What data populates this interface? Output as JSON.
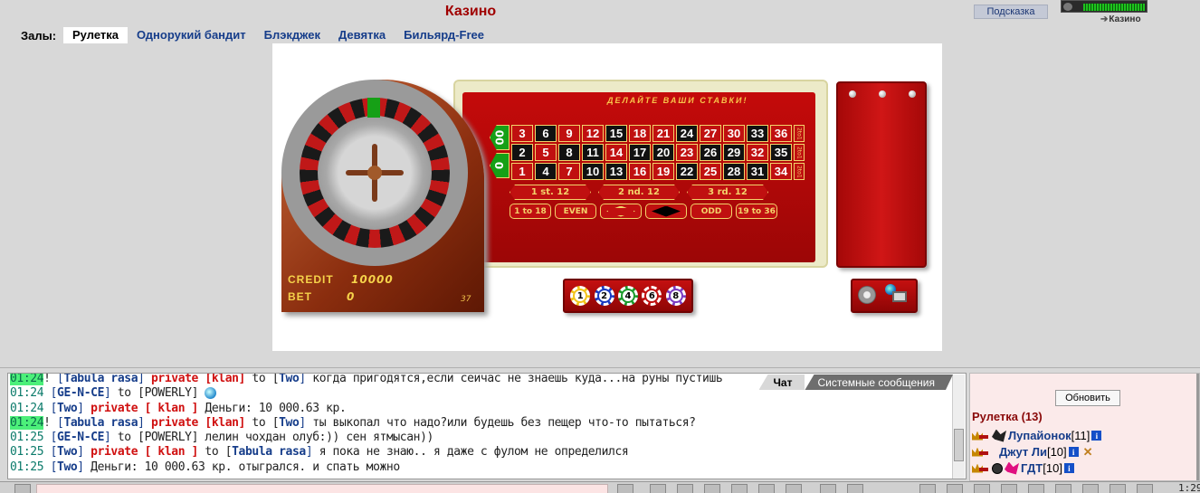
{
  "header": {
    "title": "Казино",
    "hint_button": "Подсказка",
    "status_link": "Казино",
    "halls_label": "Залы:",
    "tabs": [
      {
        "label": "Рулетка",
        "active": true
      },
      {
        "label": "Однорукий бандит",
        "active": false
      },
      {
        "label": "Блэкджек",
        "active": false
      },
      {
        "label": "Девятка",
        "active": false
      },
      {
        "label": "Бильярд-Free",
        "active": false
      }
    ]
  },
  "game": {
    "bets_title": "ДЕЛАЙТЕ ВАШИ СТАВКИ!",
    "credit_label": "CREDIT",
    "credit_value": "10000",
    "bet_label": "BET",
    "bet_value": "0",
    "spin_count": "37",
    "zero_cells": [
      "00",
      "0"
    ],
    "grid_rows": [
      [
        {
          "n": "3",
          "c": "red"
        },
        {
          "n": "6",
          "c": "black"
        },
        {
          "n": "9",
          "c": "red"
        },
        {
          "n": "12",
          "c": "red"
        },
        {
          "n": "15",
          "c": "black"
        },
        {
          "n": "18",
          "c": "red"
        },
        {
          "n": "21",
          "c": "red"
        },
        {
          "n": "24",
          "c": "black"
        },
        {
          "n": "27",
          "c": "red"
        },
        {
          "n": "30",
          "c": "red"
        },
        {
          "n": "33",
          "c": "black"
        },
        {
          "n": "36",
          "c": "red"
        }
      ],
      [
        {
          "n": "2",
          "c": "black"
        },
        {
          "n": "5",
          "c": "red"
        },
        {
          "n": "8",
          "c": "black"
        },
        {
          "n": "11",
          "c": "black"
        },
        {
          "n": "14",
          "c": "red"
        },
        {
          "n": "17",
          "c": "black"
        },
        {
          "n": "20",
          "c": "black"
        },
        {
          "n": "23",
          "c": "red"
        },
        {
          "n": "26",
          "c": "black"
        },
        {
          "n": "29",
          "c": "black"
        },
        {
          "n": "32",
          "c": "red"
        },
        {
          "n": "35",
          "c": "black"
        }
      ],
      [
        {
          "n": "1",
          "c": "red"
        },
        {
          "n": "4",
          "c": "black"
        },
        {
          "n": "7",
          "c": "red"
        },
        {
          "n": "10",
          "c": "black"
        },
        {
          "n": "13",
          "c": "black"
        },
        {
          "n": "16",
          "c": "red"
        },
        {
          "n": "19",
          "c": "red"
        },
        {
          "n": "22",
          "c": "black"
        },
        {
          "n": "25",
          "c": "red"
        },
        {
          "n": "28",
          "c": "black"
        },
        {
          "n": "31",
          "c": "black"
        },
        {
          "n": "34",
          "c": "red"
        }
      ]
    ],
    "column_bet": "2to1",
    "dozens": [
      "1 st. 12",
      "2 nd. 12",
      "3 rd. 12"
    ],
    "outside": [
      "1 to 18",
      "EVEN",
      "ODD",
      "19 to 36"
    ],
    "chips": [
      "1",
      "2",
      "4",
      "6",
      "8"
    ],
    "chip_colors": [
      "#f2c41a",
      "#1a3ac0",
      "#1a9a2a",
      "#c01010",
      "#7a3ac0"
    ]
  },
  "chat": {
    "tab_chat": "Чат",
    "tab_system": "Системные сообщения",
    "lines": [
      {
        "time": "01:24",
        "hl": true,
        "lead": "! ",
        "parts": [
          [
            "plain",
            "["
          ],
          [
            "who",
            "Tabula rasa"
          ],
          [
            "plain",
            "] "
          ],
          [
            "priv",
            "private [klan]"
          ],
          [
            "msg",
            " to ["
          ],
          [
            "who",
            "Two"
          ],
          [
            "plain",
            "] "
          ],
          [
            "msg",
            "когда пригодятся,если сейчас не знаешь куда...на руны пустишь"
          ]
        ]
      },
      {
        "time": "01:24",
        "hl": false,
        "lead": " ",
        "parts": [
          [
            "plain",
            "["
          ],
          [
            "who",
            "GE-N-CE"
          ],
          [
            "plain",
            "] "
          ],
          [
            "msg",
            "to [POWERLY] "
          ],
          [
            "emo",
            ""
          ]
        ]
      },
      {
        "time": "01:24",
        "hl": false,
        "lead": " ",
        "parts": [
          [
            "plain",
            "["
          ],
          [
            "who",
            "Two"
          ],
          [
            "plain",
            "] "
          ],
          [
            "priv",
            "private [ klan ]"
          ],
          [
            "msg",
            " Деньги: 10 000.63 кр."
          ]
        ]
      },
      {
        "time": "01:24",
        "hl": true,
        "lead": "! ",
        "parts": [
          [
            "plain",
            "["
          ],
          [
            "who",
            "Tabula rasa"
          ],
          [
            "plain",
            "] "
          ],
          [
            "priv",
            "private [klan]"
          ],
          [
            "msg",
            " to ["
          ],
          [
            "who",
            "Two"
          ],
          [
            "plain",
            "] "
          ],
          [
            "msg",
            "ты выкопал что надо?или будешь без пещер что-то пытаться?"
          ]
        ]
      },
      {
        "time": "01:25",
        "hl": false,
        "lead": " ",
        "parts": [
          [
            "plain",
            "["
          ],
          [
            "who",
            "GE-N-CE"
          ],
          [
            "plain",
            "] "
          ],
          [
            "msg",
            "to [POWERLY] лелин чохдан олуб:)) сен ятмысан))"
          ]
        ]
      },
      {
        "time": "01:25",
        "hl": false,
        "lead": " ",
        "parts": [
          [
            "plain",
            "["
          ],
          [
            "who",
            "Two"
          ],
          [
            "plain",
            "] "
          ],
          [
            "priv",
            "private [ klan ]"
          ],
          [
            "msg",
            " to ["
          ],
          [
            "who",
            "Tabula rasa"
          ],
          [
            "plain",
            "] "
          ],
          [
            "msg",
            "я пока не знаю.. я даже с фулом не определился"
          ]
        ]
      },
      {
        "time": "01:25",
        "hl": false,
        "lead": " ",
        "parts": [
          [
            "plain",
            "["
          ],
          [
            "who",
            "Two"
          ],
          [
            "plain",
            "] "
          ],
          [
            "msg",
            "Деньги: 10 000.63 кр. отыгрался. и спать можно"
          ]
        ]
      }
    ]
  },
  "users": {
    "refresh_button": "Обновить",
    "room_title": "Рулетка (13)",
    "list": [
      {
        "name": "Лупайонок",
        "level": "[11]",
        "clan": "black",
        "shield": false,
        "swords": false
      },
      {
        "name": "Джут Ли",
        "level": "[10]",
        "clan": "none",
        "shield": false,
        "swords": true
      },
      {
        "name": "ГДТ",
        "level": "[10]",
        "clan": "pink",
        "shield": true,
        "swords": false
      }
    ]
  },
  "bottom": {
    "clock": "1:29"
  }
}
